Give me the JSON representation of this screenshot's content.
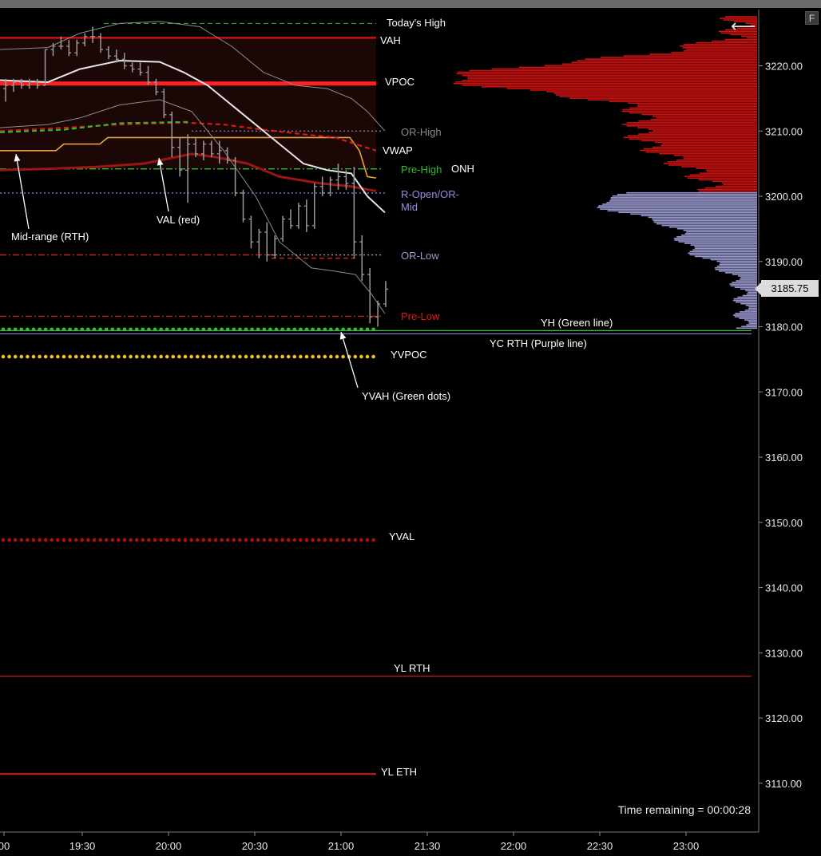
{
  "toolbar": {
    "f_label": "F",
    "back_icon": "back-arrow-icon"
  },
  "price_tag": "3185.75",
  "time_remaining": "Time remaining = 00:00:28",
  "colors": {
    "background": "#000000",
    "profile_upper": "#cc1111",
    "profile_lower": "#9a9ad2",
    "green": "#2fbf2f",
    "yellow": "#f0c419",
    "red": "#e01a1a",
    "purple": "#7d7dd6"
  },
  "chart_data": {
    "type": "line",
    "price_axis": {
      "ticks": [
        "3220.00",
        "3210.00",
        "3200.00",
        "3190.00",
        "3180.00",
        "3170.00",
        "3160.00",
        "3150.00",
        "3140.00",
        "3130.00",
        "3120.00",
        "3110.00"
      ],
      "range": [
        3105,
        3230
      ]
    },
    "time_axis": {
      "ticks": [
        "00",
        "19:30",
        "20:00",
        "20:30",
        "21:00",
        "21:30",
        "22:00",
        "22:30",
        "23:00"
      ]
    },
    "levels": [
      {
        "label": "Today's High",
        "price": 3226.5,
        "style": "dashed",
        "color": "#2fbf2f"
      },
      {
        "label": "VAH",
        "price": 3224.3,
        "style": "solid",
        "color": "#cc1111"
      },
      {
        "label": "VPOC",
        "price": 3217.3,
        "style": "solid",
        "color": "#ff2020"
      },
      {
        "label": "OR-High",
        "price": 3210.0,
        "style": "dotted",
        "color": "#8a8a8a"
      },
      {
        "label": "VWAP",
        "price": 3207.0,
        "style": "dashed",
        "color": "#e01a1a"
      },
      {
        "label": "Pre-High",
        "price": 3204.2,
        "style": "dashdot",
        "color": "#2fbf2f"
      },
      {
        "label": "ONH",
        "price": 3204.2,
        "style": "none",
        "color": "#ffffff"
      },
      {
        "label": "R-Open/OR-Mid",
        "price": 3200.5,
        "style": "dotted",
        "color": "#7d7dd6"
      },
      {
        "label": "OR-Low",
        "price": 3191.0,
        "style": "dotted",
        "color": "#9a9ad2"
      },
      {
        "label": "Pre-Low",
        "price": 3181.6,
        "style": "dashdot",
        "color": "#e01a1a"
      },
      {
        "label": "YH (Green line)",
        "price": 3179.4,
        "style": "solid",
        "color": "#2fbf2f"
      },
      {
        "label": "YC RTH (Purple line)",
        "price": 3178.9,
        "style": "solid",
        "color": "#7d7dd6"
      },
      {
        "label": "YVPOC",
        "price": 3175.4,
        "style": "dots",
        "color": "#f0c419"
      },
      {
        "label": "YVAH (Green dots)",
        "price": 3179.6,
        "style": "dots",
        "color": "#2fbf2f"
      },
      {
        "label": "YVAL",
        "price": 3147.3,
        "style": "dots",
        "color": "#b01010"
      },
      {
        "label": "YL RTH",
        "price": 3126.4,
        "style": "solid",
        "color": "#e01a1a"
      },
      {
        "label": "YL ETH",
        "price": 3111.4,
        "style": "solid",
        "color": "#e01a1a"
      }
    ],
    "annotations": [
      {
        "text": "Mid-range (RTH)"
      },
      {
        "text": "VAL (red)"
      }
    ],
    "bars": [
      {
        "o": 3216.5,
        "h": 3218.0,
        "l": 3214.5,
        "c": 3217.0
      },
      {
        "o": 3217.0,
        "h": 3218.0,
        "l": 3216.0,
        "c": 3217.5
      },
      {
        "o": 3217.5,
        "h": 3218.0,
        "l": 3216.5,
        "c": 3217.0
      },
      {
        "o": 3217.0,
        "h": 3218.0,
        "l": 3216.5,
        "c": 3217.5
      },
      {
        "o": 3217.5,
        "h": 3218.0,
        "l": 3216.5,
        "c": 3217.0
      },
      {
        "o": 3217.0,
        "h": 3222.5,
        "l": 3217.0,
        "c": 3222.5
      },
      {
        "o": 3222.5,
        "h": 3223.5,
        "l": 3221.5,
        "c": 3223.0
      },
      {
        "o": 3223.0,
        "h": 3224.5,
        "l": 3222.5,
        "c": 3223.0
      },
      {
        "o": 3223.0,
        "h": 3224.0,
        "l": 3221.5,
        "c": 3222.0
      },
      {
        "o": 3222.0,
        "h": 3224.0,
        "l": 3221.5,
        "c": 3223.5
      },
      {
        "o": 3223.5,
        "h": 3225.0,
        "l": 3223.0,
        "c": 3224.5
      },
      {
        "o": 3224.5,
        "h": 3226.0,
        "l": 3223.5,
        "c": 3224.5
      },
      {
        "o": 3224.5,
        "h": 3225.0,
        "l": 3222.0,
        "c": 3222.5
      },
      {
        "o": 3222.5,
        "h": 3223.0,
        "l": 3221.0,
        "c": 3221.5
      },
      {
        "o": 3221.5,
        "h": 3222.5,
        "l": 3220.5,
        "c": 3221.0
      },
      {
        "o": 3221.0,
        "h": 3222.0,
        "l": 3219.5,
        "c": 3220.0
      },
      {
        "o": 3220.0,
        "h": 3220.5,
        "l": 3219.0,
        "c": 3219.5
      },
      {
        "o": 3219.5,
        "h": 3220.5,
        "l": 3218.5,
        "c": 3219.0
      },
      {
        "o": 3219.0,
        "h": 3220.0,
        "l": 3217.0,
        "c": 3217.5
      },
      {
        "o": 3217.5,
        "h": 3218.0,
        "l": 3215.5,
        "c": 3216.0
      },
      {
        "o": 3216.0,
        "h": 3216.5,
        "l": 3212.0,
        "c": 3212.5
      },
      {
        "o": 3212.5,
        "h": 3213.0,
        "l": 3206.0,
        "c": 3207.5
      },
      {
        "o": 3207.5,
        "h": 3209.0,
        "l": 3203.0,
        "c": 3204.0
      },
      {
        "o": 3204.0,
        "h": 3209.5,
        "l": 3199.0,
        "c": 3208.0
      },
      {
        "o": 3208.0,
        "h": 3209.0,
        "l": 3206.0,
        "c": 3206.5
      },
      {
        "o": 3206.5,
        "h": 3208.5,
        "l": 3205.5,
        "c": 3208.0
      },
      {
        "o": 3208.0,
        "h": 3208.5,
        "l": 3206.0,
        "c": 3206.5
      },
      {
        "o": 3206.5,
        "h": 3208.5,
        "l": 3205.0,
        "c": 3207.0
      },
      {
        "o": 3207.0,
        "h": 3207.5,
        "l": 3205.0,
        "c": 3205.5
      },
      {
        "o": 3205.5,
        "h": 3206.0,
        "l": 3200.0,
        "c": 3200.5
      },
      {
        "o": 3200.5,
        "h": 3201.0,
        "l": 3196.0,
        "c": 3196.5
      },
      {
        "o": 3196.5,
        "h": 3197.0,
        "l": 3192.0,
        "c": 3193.0
      },
      {
        "o": 3193.0,
        "h": 3195.0,
        "l": 3190.5,
        "c": 3194.5
      },
      {
        "o": 3194.5,
        "h": 3196.0,
        "l": 3190.0,
        "c": 3191.0
      },
      {
        "o": 3191.0,
        "h": 3194.0,
        "l": 3190.5,
        "c": 3193.5
      },
      {
        "o": 3193.5,
        "h": 3197.0,
        "l": 3193.0,
        "c": 3196.5
      },
      {
        "o": 3196.5,
        "h": 3198.0,
        "l": 3195.0,
        "c": 3195.5
      },
      {
        "o": 3195.5,
        "h": 3199.0,
        "l": 3195.0,
        "c": 3198.5
      },
      {
        "o": 3198.5,
        "h": 3199.5,
        "l": 3194.5,
        "c": 3195.5
      },
      {
        "o": 3195.5,
        "h": 3202.0,
        "l": 3195.0,
        "c": 3201.5
      },
      {
        "o": 3201.5,
        "h": 3203.0,
        "l": 3200.0,
        "c": 3200.5
      },
      {
        "o": 3200.5,
        "h": 3203.0,
        "l": 3200.0,
        "c": 3202.5
      },
      {
        "o": 3202.5,
        "h": 3205.0,
        "l": 3201.0,
        "c": 3203.0
      },
      {
        "o": 3203.0,
        "h": 3204.0,
        "l": 3201.0,
        "c": 3202.0
      },
      {
        "o": 3202.0,
        "h": 3204.5,
        "l": 3190.5,
        "c": 3193.0
      },
      {
        "o": 3193.0,
        "h": 3194.0,
        "l": 3187.0,
        "c": 3188.0
      },
      {
        "o": 3188.0,
        "h": 3189.0,
        "l": 3180.5,
        "c": 3181.5
      },
      {
        "o": 3181.5,
        "h": 3184.0,
        "l": 3180.0,
        "c": 3183.5
      },
      {
        "o": 3183.5,
        "h": 3187.0,
        "l": 3183.0,
        "c": 3185.75
      }
    ]
  }
}
